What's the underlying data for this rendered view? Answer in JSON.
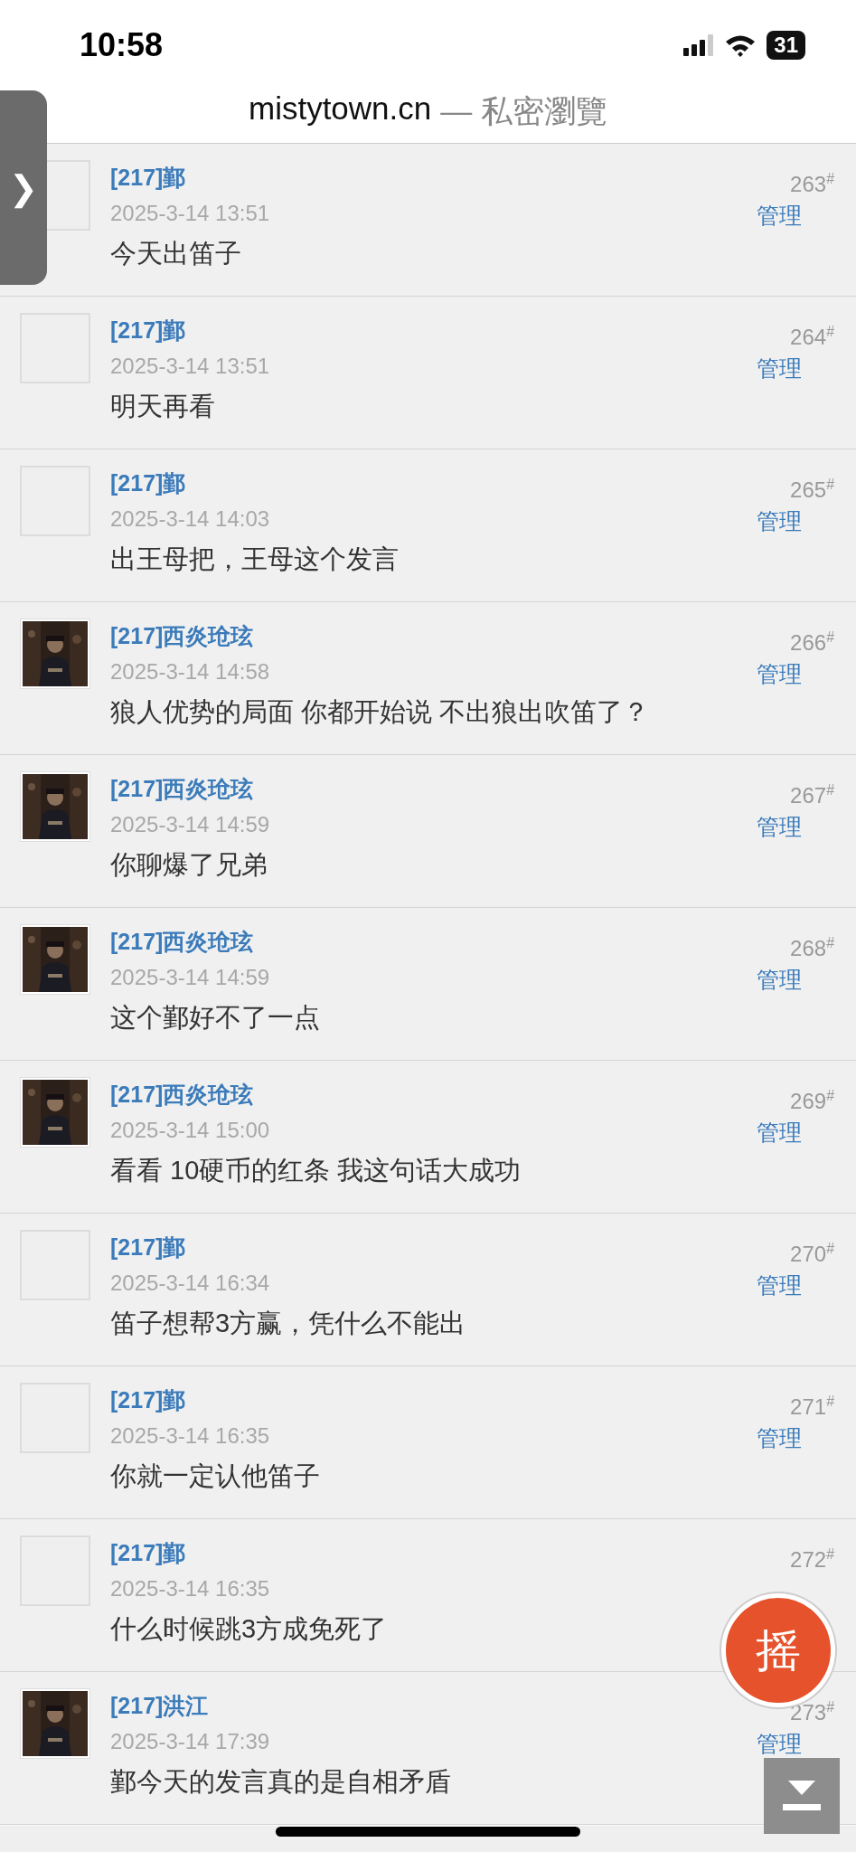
{
  "status_bar": {
    "time": "10:58",
    "battery": "31"
  },
  "address_bar": {
    "host": "mistytown.cn",
    "mode": "— 私密瀏覽"
  },
  "side_tab": {
    "glyph": "❯"
  },
  "posts": [
    {
      "avatar": {
        "kind": "blank"
      },
      "user": "[217]鄞",
      "time": "2025-3-14 13:51",
      "text": "今天出笛子",
      "floor": "263",
      "mark": "#",
      "action": "管理"
    },
    {
      "avatar": {
        "kind": "blank"
      },
      "user": "[217]鄞",
      "time": "2025-3-14 13:51",
      "text": "明天再看",
      "floor": "264",
      "mark": "#",
      "action": "管理"
    },
    {
      "avatar": {
        "kind": "blank"
      },
      "user": "[217]鄞",
      "time": "2025-3-14 14:03",
      "text": "出王母把，王母这个发言",
      "floor": "265",
      "mark": "#",
      "action": "管理"
    },
    {
      "user": "[217]西炎玱玹",
      "time": "2025-3-14 14:58",
      "text": "狼人优势的局面 你都开始说 不出狼出吹笛了？",
      "floor": "266",
      "mark": "#",
      "action": "管理"
    },
    {
      "user": "[217]西炎玱玹",
      "time": "2025-3-14 14:59",
      "text": "你聊爆了兄弟",
      "floor": "267",
      "mark": "#",
      "action": "管理"
    },
    {
      "user": "[217]西炎玱玹",
      "time": "2025-3-14 14:59",
      "text": "这个鄞好不了一点",
      "floor": "268",
      "mark": "#",
      "action": "管理"
    },
    {
      "user": "[217]西炎玱玹",
      "time": "2025-3-14 15:00",
      "text": "看看 10硬币的红条 我这句话大成功",
      "floor": "269",
      "mark": "#",
      "action": "管理"
    },
    {
      "avatar": {
        "kind": "blank"
      },
      "user": "[217]鄞",
      "time": "2025-3-14 16:34",
      "text": "笛子想帮3方赢，凭什么不能出",
      "floor": "270",
      "mark": "#",
      "action": "管理"
    },
    {
      "avatar": {
        "kind": "blank"
      },
      "user": "[217]鄞",
      "time": "2025-3-14 16:35",
      "text": "你就一定认他笛子",
      "floor": "271",
      "mark": "#",
      "action": "管理"
    },
    {
      "avatar": {
        "kind": "blank"
      },
      "user": "[217]鄞",
      "time": "2025-3-14 16:35",
      "text": "什么时候跳3方成免死了",
      "floor": "272",
      "mark": "#"
    },
    {
      "user": "[217]洪江",
      "time": "2025-3-14 17:39",
      "text": "鄞今天的发言真的是自相矛盾",
      "floor": "273",
      "mark": "#",
      "action": "管理"
    }
  ],
  "shake_button": {
    "label": "摇"
  }
}
